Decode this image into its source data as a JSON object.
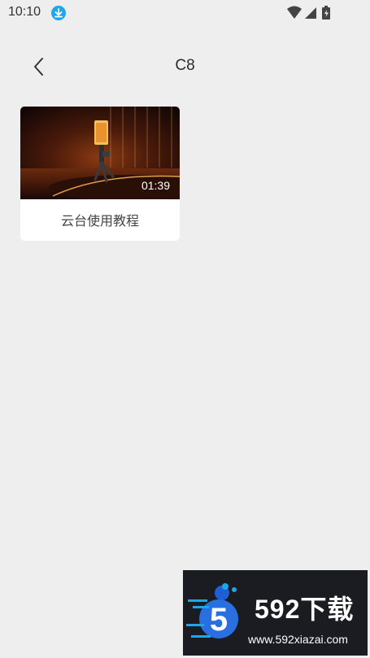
{
  "status_bar": {
    "time": "10:10",
    "icons": [
      "download-icon",
      "wifi-icon",
      "signal-icon",
      "battery-charging-icon"
    ]
  },
  "header": {
    "title": "C8",
    "back_icon": "chevron-left-icon"
  },
  "videos": [
    {
      "title": "云台使用教程",
      "duration": "01:39"
    }
  ],
  "watermark": {
    "brand": "592下载",
    "logo_digit": "5",
    "url": "www.592xiazai.com"
  },
  "colors": {
    "background": "#eeeeee",
    "card": "#ffffff",
    "accent_blue": "#1ea7ee"
  }
}
